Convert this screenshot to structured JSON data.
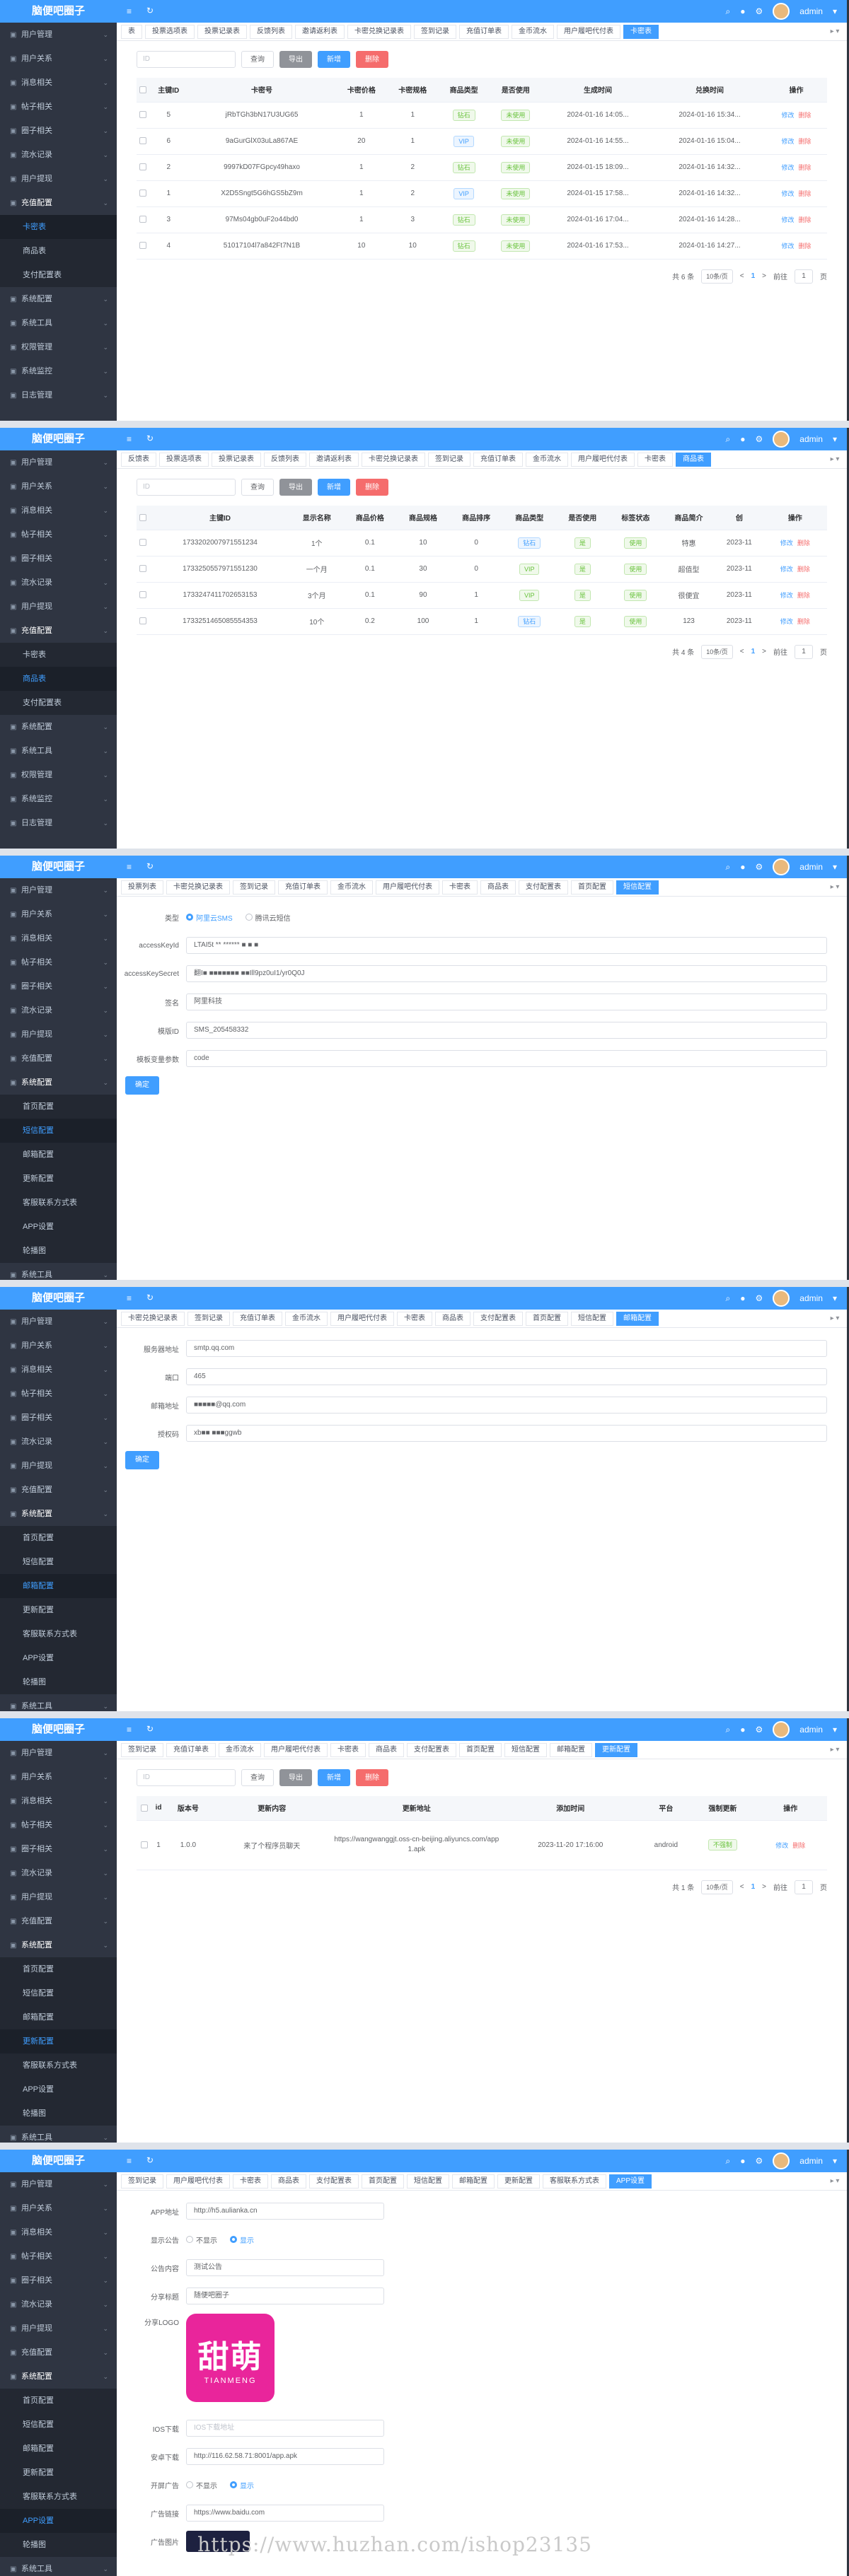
{
  "app": {
    "title": "脑便吧圈子",
    "user": "admin"
  },
  "topbar": {
    "menu_icon": "≡",
    "refresh_icon": "↻",
    "search_icon": "⌕",
    "bell_icon": "●",
    "gear_icon": "⚙",
    "user_caret": "▾"
  },
  "menu": {
    "top": [
      {
        "label": "用户管理"
      },
      {
        "label": "用户关系"
      },
      {
        "label": "消息相关"
      },
      {
        "label": "帖子相关"
      },
      {
        "label": "圈子相关"
      },
      {
        "label": "流水记录"
      },
      {
        "label": "用户提现"
      }
    ],
    "recharge": {
      "label": "充值配置",
      "items": [
        {
          "label": "卡密表"
        },
        {
          "label": "商品表"
        },
        {
          "label": "支付配置表"
        }
      ]
    },
    "lower": [
      {
        "label": "系统配置"
      },
      {
        "label": "系统工具"
      },
      {
        "label": "权限管理"
      },
      {
        "label": "系统监控"
      },
      {
        "label": "日志管理"
      }
    ],
    "system": {
      "label": "系统配置",
      "items": [
        {
          "label": "首页配置"
        },
        {
          "label": "短信配置"
        },
        {
          "label": "邮箱配置"
        },
        {
          "label": "更新配置"
        },
        {
          "label": "客服联系方式表"
        },
        {
          "label": "APP设置"
        },
        {
          "label": "轮播图"
        }
      ]
    },
    "arrow": "⌄"
  },
  "common": {
    "search_placeholder": "ID",
    "btn_query": "查询",
    "btn_export": "导出",
    "btn_add": "新增",
    "btn_delete": "删除",
    "op_edit": "修改",
    "op_delete": "删除",
    "page_size": "10条/页",
    "goto_prefix": "前往",
    "goto_page": "1",
    "goto_suffix": "页",
    "prev": "<",
    "next": ">",
    "current_page": "1",
    "submit": "确定",
    "tabs_more": "▸ ▾"
  },
  "panel1": {
    "tabs": [
      {
        "label": "表"
      },
      {
        "label": "投票选项表"
      },
      {
        "label": "投票记录表"
      },
      {
        "label": "反馈列表"
      },
      {
        "label": "邀请返利表"
      },
      {
        "label": "卡密兑换记录表"
      },
      {
        "label": "签到记录"
      },
      {
        "label": "充值订单表"
      },
      {
        "label": "金币流水"
      },
      {
        "label": "用户履吧代付表"
      },
      {
        "label": "卡密表",
        "active": true
      }
    ],
    "columns": [
      "主键ID",
      "卡密号",
      "卡密价格",
      "卡密规格",
      "商品类型",
      "是否使用",
      "生成时间",
      "兑换时间",
      "操作"
    ],
    "rows": [
      {
        "id": "5",
        "card": "jRbTGh3bN17U3UG65",
        "price": "1",
        "spec": "1",
        "type": "钻石",
        "used": "未使用",
        "created": "2024-01-16 14:05...",
        "redeemed": "2024-01-16 15:34..."
      },
      {
        "id": "6",
        "card": "9aGurGlX03uLa867AE",
        "price": "20",
        "spec": "1",
        "type": "VIP",
        "used": "未使用",
        "created": "2024-01-16 14:55...",
        "redeemed": "2024-01-16 15:04..."
      },
      {
        "id": "2",
        "card": "9997kD07FGpcy49haxo",
        "price": "1",
        "spec": "2",
        "type": "钻石",
        "used": "未使用",
        "created": "2024-01-15 18:09...",
        "redeemed": "2024-01-16 14:32..."
      },
      {
        "id": "1",
        "card": "X2D5Sngt5G6hGS5bZ9m",
        "price": "1",
        "spec": "2",
        "type": "VIP",
        "used": "未使用",
        "created": "2024-01-15 17:58...",
        "redeemed": "2024-01-16 14:32..."
      },
      {
        "id": "3",
        "card": "97Ms04gb0uF2o44bd0",
        "price": "1",
        "spec": "3",
        "type": "钻石",
        "used": "未使用",
        "created": "2024-01-16 17:04...",
        "redeemed": "2024-01-16 14:28..."
      },
      {
        "id": "4",
        "card": "51017104l7a842Ft7N1B",
        "price": "10",
        "spec": "10",
        "type": "钻石",
        "used": "未使用",
        "created": "2024-01-16 17:53...",
        "redeemed": "2024-01-16 14:27..."
      }
    ],
    "total": "共 6 条"
  },
  "panel2": {
    "tabs": [
      {
        "label": "反馈表"
      },
      {
        "label": "投票选项表"
      },
      {
        "label": "投票记录表"
      },
      {
        "label": "反馈列表"
      },
      {
        "label": "邀请返利表"
      },
      {
        "label": "卡密兑换记录表"
      },
      {
        "label": "签到记录"
      },
      {
        "label": "充值订单表"
      },
      {
        "label": "金币流水"
      },
      {
        "label": "用户履吧代付表"
      },
      {
        "label": "卡密表"
      },
      {
        "label": "商品表",
        "active": true
      }
    ],
    "columns": [
      "主键ID",
      "显示名称",
      "商品价格",
      "商品规格",
      "商品排序",
      "商品类型",
      "是否使用",
      "标签状态",
      "商品简介",
      "创",
      "操作"
    ],
    "rows": [
      {
        "id": "1733202007971551234",
        "name": "1个",
        "price": "0.1",
        "spec": "10",
        "sort": "0",
        "type": "钻石",
        "used": "是",
        "status": "使用",
        "intro": "特惠",
        "date": "2023-11"
      },
      {
        "id": "1733250557971551230",
        "name": "一个月",
        "price": "0.1",
        "spec": "30",
        "sort": "0",
        "type": "VIP",
        "used": "是",
        "status": "使用",
        "intro": "超值型",
        "date": "2023-11"
      },
      {
        "id": "1733247411702653153",
        "name": "3个月",
        "price": "0.1",
        "spec": "90",
        "sort": "1",
        "type": "VIP",
        "used": "是",
        "status": "使用",
        "intro": "很便宜",
        "date": "2023-11"
      },
      {
        "id": "1733251465085554353",
        "name": "10个",
        "price": "0.2",
        "spec": "100",
        "sort": "1",
        "type": "钻石",
        "used": "是",
        "status": "使用",
        "intro": "123",
        "date": "2023-11"
      }
    ],
    "total": "共 4 条"
  },
  "panel3": {
    "tabs": [
      {
        "label": "投票列表"
      },
      {
        "label": "卡密兑换记录表"
      },
      {
        "label": "签到记录"
      },
      {
        "label": "充值订单表"
      },
      {
        "label": "金币流水"
      },
      {
        "label": "用户履吧代付表"
      },
      {
        "label": "卡密表"
      },
      {
        "label": "商品表"
      },
      {
        "label": "支付配置表"
      },
      {
        "label": "首页配置"
      },
      {
        "label": "短信配置",
        "active": true
      }
    ],
    "type_label": "类型",
    "type_options": [
      "阿里云SMS",
      "腾讯云短信"
    ],
    "fields": [
      {
        "label": "accessKeyId",
        "value": "LTAI5t ** ****** ■ ■ ■"
      },
      {
        "label": "accessKeySecret",
        "value": "翻I■ ■■■■■■■  ■■Ill9pz0uI1/yr0Q0J"
      },
      {
        "label": "签名",
        "value": "阿里科技"
      },
      {
        "label": "模版ID",
        "value": "SMS_205458332"
      },
      {
        "label": "模板变量参数",
        "value": "code"
      }
    ]
  },
  "panel4": {
    "tabs": [
      {
        "label": "卡密兑换记录表"
      },
      {
        "label": "签到记录"
      },
      {
        "label": "充值订单表"
      },
      {
        "label": "金币流水"
      },
      {
        "label": "用户履吧代付表"
      },
      {
        "label": "卡密表"
      },
      {
        "label": "商品表"
      },
      {
        "label": "支付配置表"
      },
      {
        "label": "首页配置"
      },
      {
        "label": "短信配置"
      },
      {
        "label": "邮箱配置",
        "active": true
      }
    ],
    "fields": [
      {
        "label": "服务器地址",
        "value": "smtp.qq.com"
      },
      {
        "label": "端口",
        "value": "465"
      },
      {
        "label": "邮箱地址",
        "value": "■■■■■@qq.com"
      },
      {
        "label": "授权码",
        "value": "xb■■ ■■■ggwb"
      }
    ]
  },
  "panel5": {
    "tabs": [
      {
        "label": "签到记录"
      },
      {
        "label": "充值订单表"
      },
      {
        "label": "金币流水"
      },
      {
        "label": "用户履吧代付表"
      },
      {
        "label": "卡密表"
      },
      {
        "label": "商品表"
      },
      {
        "label": "支付配置表"
      },
      {
        "label": "首页配置"
      },
      {
        "label": "短信配置"
      },
      {
        "label": "邮箱配置"
      },
      {
        "label": "更新配置",
        "active": true
      }
    ],
    "columns": [
      "id",
      "版本号",
      "更新内容",
      "更新地址",
      "添加时间",
      "平台",
      "强制更新",
      "操作"
    ],
    "rows": [
      {
        "id": "1",
        "version": "1.0.0",
        "content": "来了个程序员聊天",
        "url": "https://wangwanggjt.oss-cn-beijing.aliyuncs.com/app1.apk",
        "added": "2023-11-20 17:16:00",
        "platform": "android",
        "force": "不强制"
      }
    ],
    "total": "共 1 条"
  },
  "panel6": {
    "tabs": [
      {
        "label": "签到记录"
      },
      {
        "label": "用户履吧代付表"
      },
      {
        "label": "卡密表"
      },
      {
        "label": "商品表"
      },
      {
        "label": "支付配置表"
      },
      {
        "label": "首页配置"
      },
      {
        "label": "短信配置"
      },
      {
        "label": "邮箱配置"
      },
      {
        "label": "更新配置"
      },
      {
        "label": "客服联系方式表"
      },
      {
        "label": "APP设置",
        "active": true
      }
    ],
    "app_url_label": "APP地址",
    "app_url": "http://h5.aulianka.cn",
    "notice_label": "显示公告",
    "notice_options": [
      "不显示",
      "显示"
    ],
    "notice_content_label": "公告内容",
    "notice_content": "测试公告",
    "share_title_label": "分享标题",
    "share_title": "随便吧圈子",
    "share_logo_label": "分享LOGO",
    "logo_text": "甜萌",
    "logo_sub": "TIANMENG",
    "ios_label": "IOS下载",
    "ios_placeholder": "IOS下载地址",
    "android_label": "安卓下载",
    "android_url": "http://116.62.58.71:8001/app.apk",
    "ad_label": "开屏广告",
    "ad_options": [
      "不显示",
      "显示"
    ],
    "ad_link_label": "广告链接",
    "ad_link": "https://www.baidu.com",
    "ad_img_label": "广告图片",
    "watermark": "https://www.huzhan.com/ishop23135"
  }
}
